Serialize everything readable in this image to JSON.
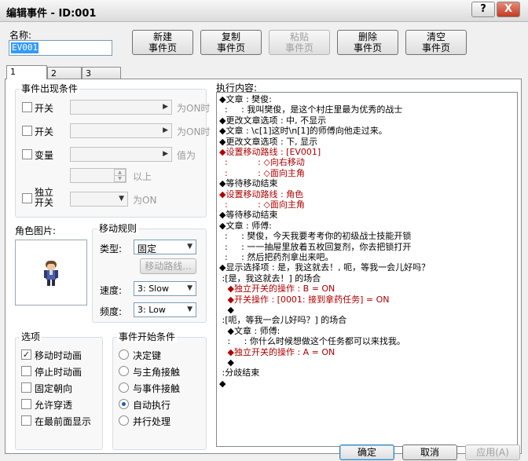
{
  "window": {
    "title": "编辑事件 - ID:001",
    "help_label": "?",
    "close_label": "X"
  },
  "name": {
    "label": "名称:",
    "value": "EV001"
  },
  "page_buttons": {
    "new": "新建\n事件页",
    "copy": "复制\n事件页",
    "paste": "粘贴\n事件页",
    "delete": "删除\n事件页",
    "clear": "清空\n事件页"
  },
  "tabs": [
    "1",
    "2",
    "3"
  ],
  "conditions": {
    "group_label": "事件出现条件",
    "switch1": {
      "label": "开关",
      "suffix": "为ON时"
    },
    "switch2": {
      "label": "开关",
      "suffix": "为ON时"
    },
    "variable": {
      "label": "变量",
      "suffix": "值为",
      "above": "以上"
    },
    "self_switch": {
      "label": "独立\n开关",
      "suffix": "为ON"
    }
  },
  "graphic": {
    "label": "角色图片:"
  },
  "movement": {
    "group_label": "移动规则",
    "type_label": "类型:",
    "type_value": "固定",
    "route_button": "移动路线...",
    "speed_label": "速度:",
    "speed_value": "3: Slow",
    "freq_label": "频度:",
    "freq_value": "3: Low"
  },
  "options": {
    "group_label": "选项",
    "items": [
      {
        "label": "移动时动画",
        "checked": true
      },
      {
        "label": "停止时动画",
        "checked": false
      },
      {
        "label": "固定朝向",
        "checked": false
      },
      {
        "label": "允许穿透",
        "checked": false
      },
      {
        "label": "在最前面显示",
        "checked": false
      }
    ]
  },
  "trigger": {
    "group_label": "事件开始条件",
    "items": [
      {
        "label": "决定键",
        "selected": false
      },
      {
        "label": "与主角接触",
        "selected": false
      },
      {
        "label": "与事件接触",
        "selected": false
      },
      {
        "label": "自动执行",
        "selected": true
      },
      {
        "label": "并行处理",
        "selected": false
      }
    ]
  },
  "contents": {
    "label": "执行内容:",
    "lines": [
      {
        "text": "◆文章 : 樊俊:",
        "color": "black"
      },
      {
        "text": "  :     : 我叫樊俊，是这个村庄里最为优秀的战士",
        "color": "black"
      },
      {
        "text": "◆更改文章选项 : 中, 不显示",
        "color": "black"
      },
      {
        "text": "◆文章 : \\c[1]这时\\n[1]的师傅向他走过来。",
        "color": "black"
      },
      {
        "text": "◆更改文章选项 : 下, 显示",
        "color": "black"
      },
      {
        "text": "◆设置移动路线 : [EV001]",
        "color": "red"
      },
      {
        "text": "  :           : ◇向右移动",
        "color": "red"
      },
      {
        "text": "  :           : ◇面向主角",
        "color": "red"
      },
      {
        "text": "◆等待移动结束",
        "color": "black"
      },
      {
        "text": "◆设置移动路线 : 角色",
        "color": "red"
      },
      {
        "text": "  :           : ◇面向主角",
        "color": "red"
      },
      {
        "text": "◆等待移动结束",
        "color": "black"
      },
      {
        "text": "◆文章 : 师傅:",
        "color": "black"
      },
      {
        "text": "  :     : 樊俊，今天我要考考你的初级战士技能开锁",
        "color": "black"
      },
      {
        "text": "  :     : 一一抽屉里放着五枚回复剂，你去把锁打开",
        "color": "black"
      },
      {
        "text": "  :     : 然后把药剂拿出来吧。",
        "color": "black"
      },
      {
        "text": "◆显示选择项 : 是，我这就去！, 呃，等我一会儿好吗？",
        "color": "black"
      },
      {
        "text": " :[是，我这就去！] 的场合",
        "color": "black"
      },
      {
        "text": "   ◆独立开关的操作 : B = ON",
        "color": "red"
      },
      {
        "text": "   ◆开关操作 : [0001: 接到拿药任务] = ON",
        "color": "red"
      },
      {
        "text": "   ◆",
        "color": "black"
      },
      {
        "text": " :[呃，等我一会儿好吗？] 的场合",
        "color": "black"
      },
      {
        "text": "   ◆文章 : 师傅:",
        "color": "black"
      },
      {
        "text": "   :     : 你什么时候想做这个任务都可以来找我。",
        "color": "black"
      },
      {
        "text": "   ◆独立开关的操作 : A = ON",
        "color": "red"
      },
      {
        "text": "   ◆",
        "color": "black"
      },
      {
        "text": " :分歧结束",
        "color": "black"
      },
      {
        "text": "◆",
        "color": "black"
      }
    ]
  },
  "footer": {
    "ok": "确定",
    "cancel": "取消",
    "apply": "应用(A)"
  },
  "colors": {
    "red_text": "#b00000",
    "selection": "#3399ff"
  }
}
